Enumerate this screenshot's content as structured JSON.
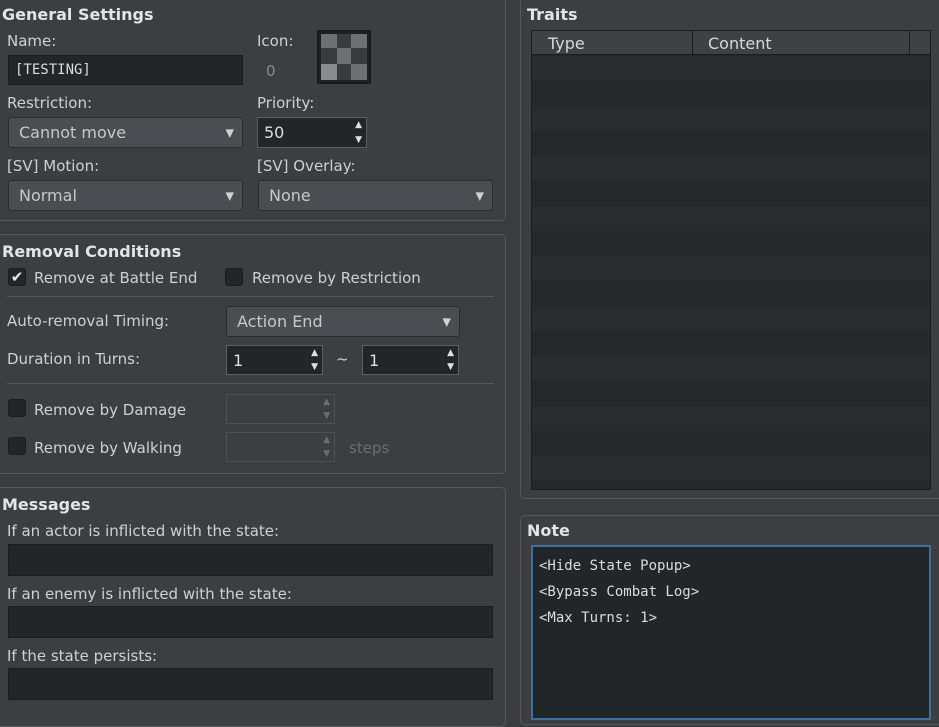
{
  "general": {
    "title": "General Settings",
    "name_label": "Name:",
    "name_value": "[TESTING]",
    "icon_label": "Icon:",
    "icon_index": "0",
    "restriction_label": "Restriction:",
    "restriction_value": "Cannot move",
    "priority_label": "Priority:",
    "priority_value": "50",
    "motion_label": "[SV] Motion:",
    "motion_value": "Normal",
    "overlay_label": "[SV] Overlay:",
    "overlay_value": "None"
  },
  "removal": {
    "title": "Removal Conditions",
    "battle_end_label": "Remove at Battle End",
    "battle_end_checked": true,
    "restriction_label": "Remove by Restriction",
    "restriction_checked": false,
    "timing_label": "Auto-removal Timing:",
    "timing_value": "Action End",
    "duration_label": "Duration in Turns:",
    "duration_min": "1",
    "duration_tilde": "~",
    "duration_max": "1",
    "damage_label": "Remove by Damage",
    "damage_checked": false,
    "walking_label": "Remove by Walking",
    "walking_checked": false,
    "steps_label": "steps"
  },
  "messages": {
    "title": "Messages",
    "actor_label": "If an actor is inflicted with the state:",
    "enemy_label": "If an enemy is inflicted with the state:",
    "persist_label": "If the state persists:"
  },
  "traits": {
    "title": "Traits",
    "col_type": "Type",
    "col_content": "Content"
  },
  "note": {
    "title": "Note",
    "lines": [
      "<Hide State Popup>",
      "<Bypass Combat Log>",
      "<Max Turns: 1>"
    ]
  },
  "icons": {
    "dropdown": "chevron-down-icon",
    "spinner": "spinner-arrows-icon",
    "check": "checkmark-icon"
  },
  "colors": {
    "panel_bg": "#3c3e41",
    "field_bg": "#232629",
    "note_focus": "#3f6f9c"
  }
}
